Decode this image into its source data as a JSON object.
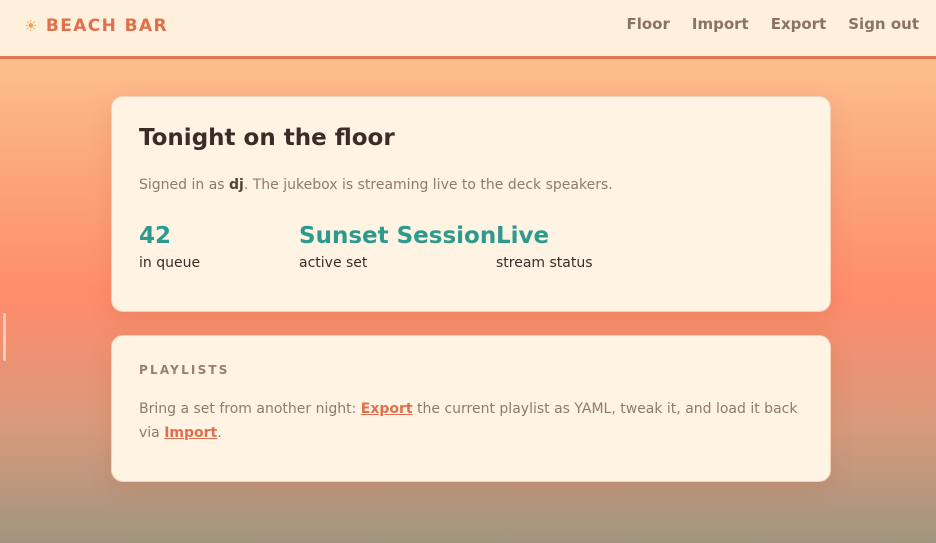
{
  "header": {
    "brand_icon": "☀",
    "brand": "BEACH BAR",
    "nav": [
      "Floor",
      "Import",
      "Export",
      "Sign out"
    ]
  },
  "summary": {
    "title": "Tonight on the floor",
    "signed_prefix": "Signed in as ",
    "user": "dj",
    "signed_suffix": ". The jukebox is streaming live to the deck speakers.",
    "stats": [
      {
        "value": "42",
        "label": "in queue"
      },
      {
        "value": "Sunset Session",
        "label": "active set"
      },
      {
        "value": "Live",
        "label": "stream status"
      }
    ]
  },
  "playlists": {
    "heading": "PLAYLISTS",
    "text_1": "Bring a set from another night: ",
    "link_export": "Export",
    "text_2": " the current playlist as YAML, tweak it, and load it back via ",
    "link_import": "Import",
    "text_3": "."
  },
  "colors": {
    "accent": "#e0704d",
    "stat": "#2c9a8d",
    "card": "#fff3e3",
    "header": "#fff0dc"
  }
}
